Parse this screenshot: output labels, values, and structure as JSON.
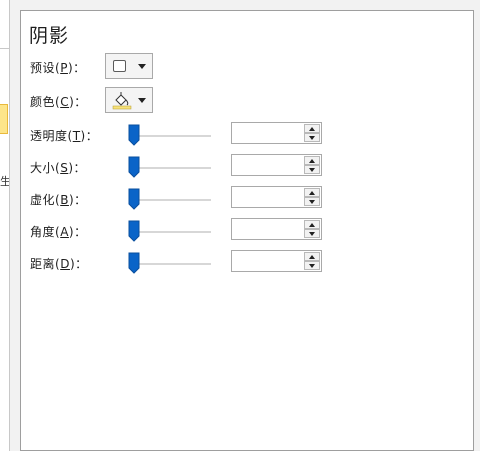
{
  "nav": {
    "fragment_char": "生"
  },
  "section": {
    "title": "阴影"
  },
  "preset": {
    "label": "预设",
    "key": "P",
    "suffix": "：",
    "icon": "square-outline-icon"
  },
  "color": {
    "label": "颜色",
    "key": "C",
    "suffix": "：",
    "icon": "paint-bucket-icon"
  },
  "rows": [
    {
      "label": "透明度",
      "key": "T",
      "suffix": "：",
      "value": ""
    },
    {
      "label": "大小",
      "key": "S",
      "suffix": "：",
      "value": ""
    },
    {
      "label": "虚化",
      "key": "B",
      "suffix": "：",
      "value": ""
    },
    {
      "label": "角度",
      "key": "A",
      "suffix": "：",
      "value": ""
    },
    {
      "label": "距离",
      "key": "D",
      "suffix": "：",
      "value": ""
    }
  ],
  "colors": {
    "accent": "#0a64c8",
    "selection": "#fde58a",
    "border": "#a9a9a9"
  }
}
